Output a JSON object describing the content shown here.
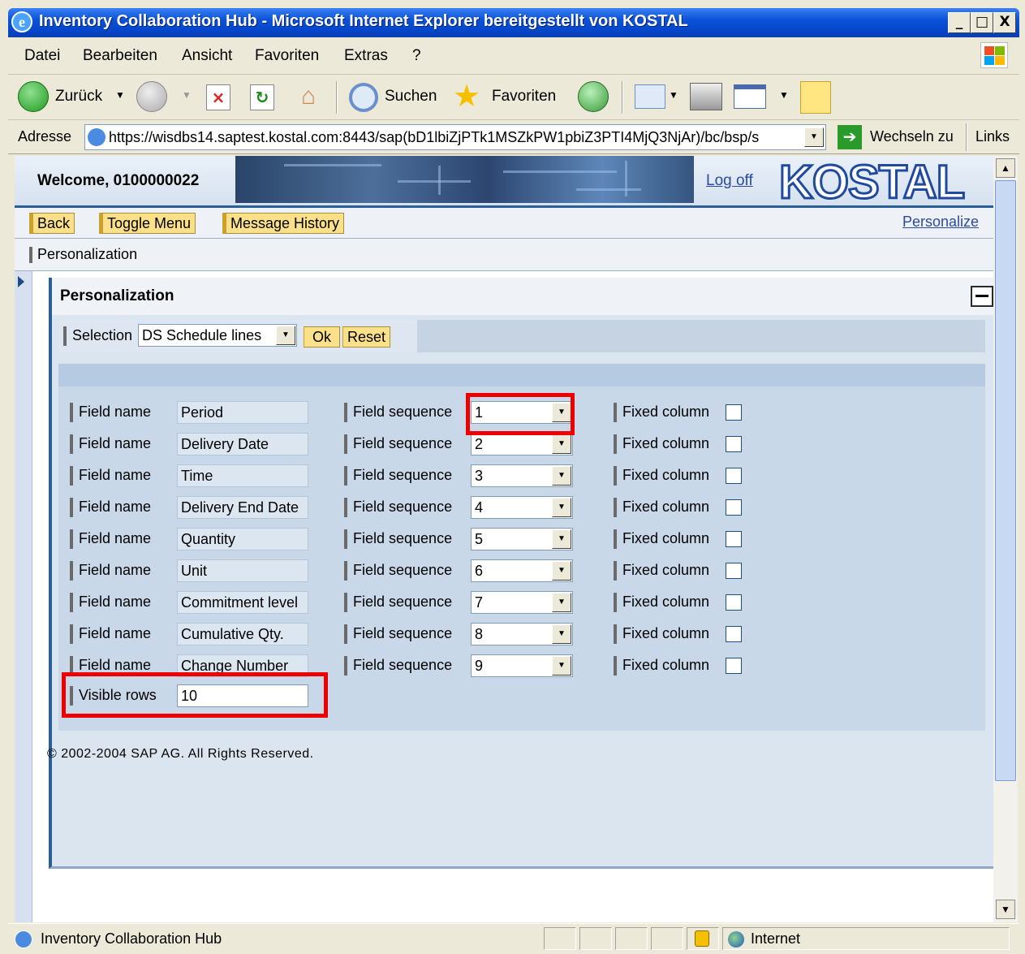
{
  "window": {
    "title": "Inventory Collaboration Hub - Microsoft Internet Explorer bereitgestellt von KOSTAL",
    "minimize": "_",
    "maximize": "□",
    "close": "X"
  },
  "menu": [
    "Datei",
    "Bearbeiten",
    "Ansicht",
    "Favoriten",
    "Extras",
    "?"
  ],
  "toolbar": {
    "back": "Zurück",
    "search": "Suchen",
    "favorites": "Favoriten"
  },
  "address": {
    "label": "Adresse",
    "url": "https://wisdbs14.saptest.kostal.com:8443/sap(bD1lbiZjPTk1MSZkPW1pbiZ3PTI4MjQ3NjAr)/bc/bsp/s",
    "go": "Wechseln zu",
    "links": "Links"
  },
  "header": {
    "welcome": "Welcome,  0100000022",
    "logoff": "Log off",
    "logo": "KOSTAL"
  },
  "nav": {
    "back": "Back",
    "toggle_menu": "Toggle Menu",
    "message_history": "Message History",
    "personalize": "Personalize"
  },
  "breadcrumb": "Personalization",
  "panel": {
    "title": "Personalization",
    "selection_label": "Selection",
    "selection_value": "DS Schedule lines",
    "ok": "Ok",
    "reset": "Reset",
    "field_name_label": "Field name",
    "field_sequence_label": "Field sequence",
    "fixed_column_label": "Fixed column",
    "rows": [
      {
        "name": "Period",
        "sequence": "1",
        "fixed": false
      },
      {
        "name": "Delivery Date",
        "sequence": "2",
        "fixed": false
      },
      {
        "name": "Time",
        "sequence": "3",
        "fixed": false
      },
      {
        "name": "Delivery End Date",
        "sequence": "4",
        "fixed": false
      },
      {
        "name": "Quantity",
        "sequence": "5",
        "fixed": false
      },
      {
        "name": "Unit",
        "sequence": "6",
        "fixed": false
      },
      {
        "name": "Commitment level",
        "sequence": "7",
        "fixed": false
      },
      {
        "name": "Cumulative Qty.",
        "sequence": "8",
        "fixed": false
      },
      {
        "name": "Change Number",
        "sequence": "9",
        "fixed": false
      }
    ],
    "visible_rows_label": "Visible rows",
    "visible_rows_value": "10"
  },
  "copyright": "© 2002-2004 SAP AG. All Rights Reserved.",
  "status": {
    "text": "Inventory Collaboration Hub",
    "zone": "Internet"
  },
  "colors": {
    "highlight": "#e00000",
    "sap_button": "#fbe08a",
    "panel_bg": "#c9d8e9"
  }
}
